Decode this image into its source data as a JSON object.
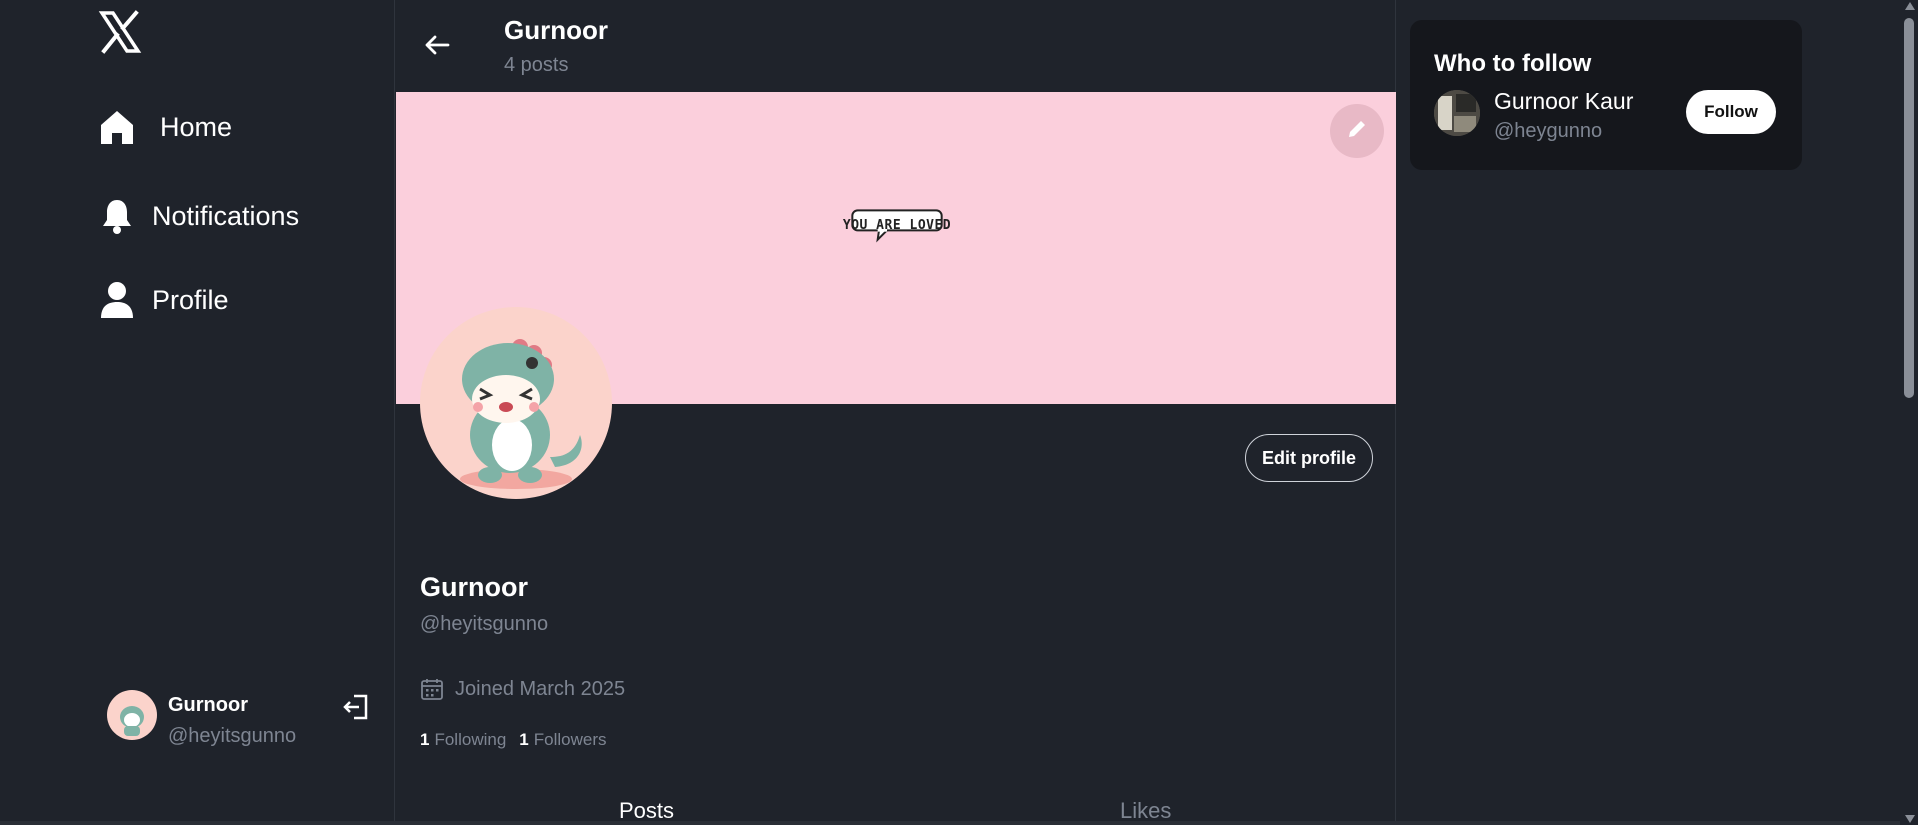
{
  "sidebar": {
    "logo": "x-logo-icon",
    "nav": [
      {
        "label": "Home",
        "icon": "home-icon"
      },
      {
        "label": "Notifications",
        "icon": "bell-icon"
      },
      {
        "label": "Profile",
        "icon": "person-icon"
      }
    ],
    "account": {
      "name": "Gurnoor",
      "handle": "@heyitsgunno",
      "logout_icon": "logout-icon"
    }
  },
  "header": {
    "title": "Gurnoor",
    "posts_count": "4 posts",
    "back_icon": "back-arrow-icon"
  },
  "banner": {
    "text": "YOU ARE LOVED",
    "background": "#fbcfdc",
    "edit_icon": "pencil-icon"
  },
  "profile": {
    "edit_button": "Edit profile",
    "name": "Gurnoor",
    "handle": "@heyitsgunno",
    "joined": "Joined March 2025",
    "following_count": "1",
    "following_label": "Following",
    "followers_count": "1",
    "followers_label": "Followers"
  },
  "tabs": [
    {
      "label": "Posts",
      "active": true
    },
    {
      "label": "Likes",
      "active": false
    }
  ],
  "who_to_follow": {
    "title": "Who to follow",
    "users": [
      {
        "name": "Gurnoor Kaur",
        "handle": "@heygunno",
        "button": "Follow"
      }
    ]
  },
  "colors": {
    "background": "#1f232b",
    "muted": "#7e8592",
    "card": "#15171c"
  }
}
